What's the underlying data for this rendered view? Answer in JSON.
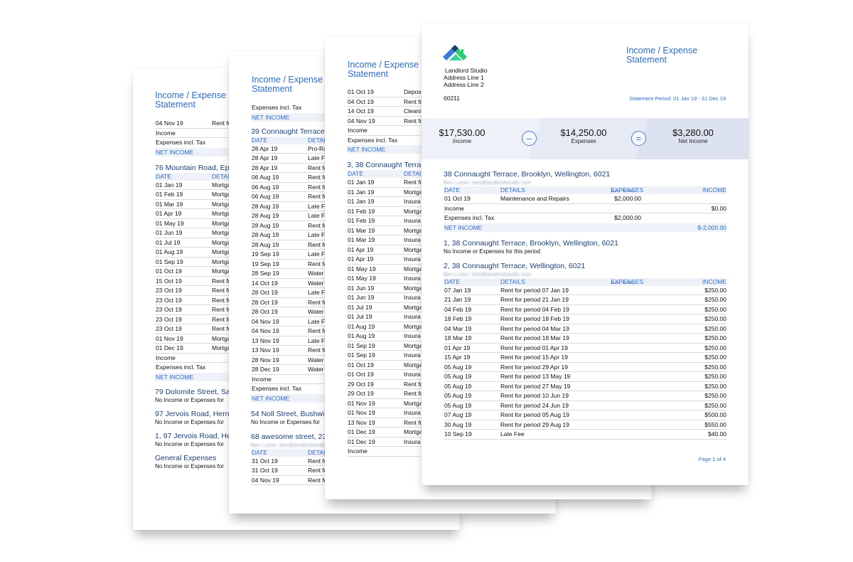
{
  "page1": {
    "title_line1": "Income / Expense",
    "title_line2": "Statement",
    "carry_rows": [
      {
        "date": "04 Nov 19",
        "details": "Rent fo"
      }
    ],
    "income_label": "Income",
    "expenses_label": "Expenses incl. Tax",
    "net_label": "NET INCOME",
    "section1": {
      "title": "76 Mountain Road, Eps",
      "headers": {
        "date": "DATE",
        "details": "DETAI"
      },
      "rows": [
        {
          "date": "01 Jan 19",
          "details": "Mortga"
        },
        {
          "date": "01 Feb 19",
          "details": "Mortga"
        },
        {
          "date": "01 Mar 19",
          "details": "Mortga"
        },
        {
          "date": "01 Apr 19",
          "details": "Mortga"
        },
        {
          "date": "01 May 19",
          "details": "Mortga"
        },
        {
          "date": "01 Jun 19",
          "details": "Mortga"
        },
        {
          "date": "01 Jul 19",
          "details": "Mortga"
        },
        {
          "date": "01 Aug 19",
          "details": "Mortga"
        },
        {
          "date": "01 Sep 19",
          "details": "Mortga"
        },
        {
          "date": "01 Oct 19",
          "details": "Mortga"
        },
        {
          "date": "15 Oct 19",
          "details": "Rent fo"
        },
        {
          "date": "23 Oct 19",
          "details": "Rent fo"
        },
        {
          "date": "23 Oct 19",
          "details": "Rent fo"
        },
        {
          "date": "23 Oct 19",
          "details": "Rent fo"
        },
        {
          "date": "23 Oct 19",
          "details": "Rent fo"
        },
        {
          "date": "23 Oct 19",
          "details": "Rent fo"
        },
        {
          "date": "01 Nov 19",
          "details": "Mortga"
        },
        {
          "date": "01 Dec 19",
          "details": "Mortga"
        }
      ]
    },
    "empty_sections": [
      {
        "title": "79 Dolomite Street, Sa",
        "note": "No Income or Expenses for"
      },
      {
        "title": "97 Jervois Road, Herne",
        "note": "No Income or Expenses for"
      },
      {
        "title": "1, 97 Jervois Road, He",
        "note": "No Income or Expenses for"
      },
      {
        "title": "General Expenses",
        "note": "No Income or Expenses for"
      }
    ]
  },
  "page2": {
    "title_line1": "Income / Expense",
    "title_line2": "Statement",
    "expenses_label": "Expenses incl. Tax",
    "net_label": "NET INCOME",
    "income_label": "Income",
    "section1": {
      "title": "39 Connaught Terrace",
      "headers": {
        "date": "DATE",
        "details": "DETAI"
      },
      "rows": [
        {
          "date": "28 Apr 19",
          "details": "Pro-Ra"
        },
        {
          "date": "28 Apr 19",
          "details": "Late F"
        },
        {
          "date": "28 Apr 19",
          "details": "Rent fo"
        },
        {
          "date": "06 Aug 19",
          "details": "Rent fo"
        },
        {
          "date": "06 Aug 19",
          "details": "Rent fo"
        },
        {
          "date": "06 Aug 19",
          "details": "Rent fo"
        },
        {
          "date": "28 Aug 19",
          "details": "Late F"
        },
        {
          "date": "28 Aug 19",
          "details": "Late F"
        },
        {
          "date": "28 Aug 19",
          "details": "Rent fo"
        },
        {
          "date": "28 Aug 19",
          "details": "Late F"
        },
        {
          "date": "28 Aug 19",
          "details": "Rent fo"
        },
        {
          "date": "19 Sep 19",
          "details": "Late F"
        },
        {
          "date": "19 Sep 19",
          "details": "Rent fo"
        },
        {
          "date": "28 Sep 19",
          "details": "Water"
        },
        {
          "date": "14 Oct 19",
          "details": "Water"
        },
        {
          "date": "28 Oct 19",
          "details": "Late F"
        },
        {
          "date": "28 Oct 19",
          "details": "Rent fo"
        },
        {
          "date": "28 Oct 19",
          "details": "Water"
        },
        {
          "date": "04 Nov 19",
          "details": "Late F"
        },
        {
          "date": "04 Nov 19",
          "details": "Rent fo"
        },
        {
          "date": "13 Nov 19",
          "details": "Late F"
        },
        {
          "date": "13 Nov 19",
          "details": "Rent fo"
        },
        {
          "date": "28 Nov 19",
          "details": "Water"
        },
        {
          "date": "28 Dec 19",
          "details": "Water"
        }
      ]
    },
    "empty_section": {
      "title": "54 Noll Street, Bushwi",
      "note": "No Income or Expenses for"
    },
    "section2": {
      "title": "68 awesome street, 23",
      "contact": "Ben Luxon, ben@landlordstudio",
      "headers": {
        "date": "DATE",
        "details": "DETAI"
      },
      "rows": [
        {
          "date": "31 Oct 19",
          "details": "Rent fo"
        },
        {
          "date": "31 Oct 19",
          "details": "Rent fo"
        },
        {
          "date": "04 Nov 19",
          "details": "Rent fo"
        }
      ]
    }
  },
  "page3": {
    "title_line1": "Income / Expense",
    "title_line2": "Statement",
    "carry_rows": [
      {
        "date": "01 Oct 19",
        "details": "Depos"
      },
      {
        "date": "04 Oct 19",
        "details": "Rent fo"
      },
      {
        "date": "14 Oct 19",
        "details": "Cleani"
      },
      {
        "date": "04 Nov 19",
        "details": "Rent fo"
      }
    ],
    "income_label": "Income",
    "expenses_label": "Expenses incl. Tax",
    "net_label": "NET INCOME",
    "section1": {
      "title": "3, 38 Connaught Terra",
      "headers": {
        "date": "DATE",
        "details": "DETAI"
      },
      "rows": [
        {
          "date": "01 Jan 19",
          "details": "Rent fo"
        },
        {
          "date": "01 Jan 19",
          "details": "Mortga"
        },
        {
          "date": "01 Jan 19",
          "details": "Insura"
        },
        {
          "date": "01 Feb 19",
          "details": "Mortga"
        },
        {
          "date": "01 Feb 19",
          "details": "Insura"
        },
        {
          "date": "01 Mar 19",
          "details": "Mortga"
        },
        {
          "date": "01 Mar 19",
          "details": "Insura"
        },
        {
          "date": "01 Apr 19",
          "details": "Mortga"
        },
        {
          "date": "01 Apr 19",
          "details": "Insura"
        },
        {
          "date": "01 May 19",
          "details": "Mortga"
        },
        {
          "date": "01 May 19",
          "details": "Insura"
        },
        {
          "date": "01 Jun 19",
          "details": "Mortga"
        },
        {
          "date": "01 Jun 19",
          "details": "Insura"
        },
        {
          "date": "01 Jul 19",
          "details": "Mortga"
        },
        {
          "date": "01 Jul 19",
          "details": "Insura"
        },
        {
          "date": "01 Aug 19",
          "details": "Mortga"
        },
        {
          "date": "01 Aug 19",
          "details": "Insura"
        },
        {
          "date": "01 Sep 19",
          "details": "Mortga"
        },
        {
          "date": "01 Sep 19",
          "details": "Insura"
        },
        {
          "date": "01 Oct 19",
          "details": "Mortga"
        },
        {
          "date": "01 Oct 19",
          "details": "Insura"
        },
        {
          "date": "29 Oct 19",
          "details": "Rent fo"
        },
        {
          "date": "29 Oct 19",
          "details": "Rent fo"
        },
        {
          "date": "01 Nov 19",
          "details": "Mortga"
        },
        {
          "date": "01 Nov 19",
          "details": "Insura"
        },
        {
          "date": "13 Nov 19",
          "details": "Rent fo"
        },
        {
          "date": "01 Dec 19",
          "details": "Mortga"
        },
        {
          "date": "01 Dec 19",
          "details": "Insura"
        }
      ]
    }
  },
  "page4": {
    "company": {
      "name": "Landlord Studio",
      "address1": "Address Line 1",
      "address2": "Address Line 2",
      "postcode": "60211"
    },
    "title_line1": "Income / Expense",
    "title_line2": "Statement",
    "period": "Statement Period: 01 Jan 19 - 31 Dec 19",
    "summary": {
      "income_amount": "$17,530.00",
      "income_label": "Income",
      "minus_symbol": "–",
      "expenses_amount": "$14,250.00",
      "expenses_label": "Expenses",
      "equals_symbol": "=",
      "net_amount": "$3,280.00",
      "net_label": "Net Income"
    },
    "headers": {
      "date": "DATE",
      "details": "DETAILS",
      "expenses": "EXPENSES",
      "expenses_note": "(INCL. TAXES)",
      "income": "INCOME"
    },
    "section1": {
      "title": "38 Connaught Terrace, Brooklyn, Wellington, 6021",
      "contact": "Ben Luxon, ben@landlordstudio.com",
      "rows": [
        {
          "date": "01 Oct 19",
          "details": "Maintenance and Repairs",
          "expenses": "$2,000.00",
          "income": ""
        }
      ],
      "income_label": "Income",
      "income_total": "$0.00",
      "expenses_label": "Expenses incl. Tax",
      "expenses_total": "$2,000.00",
      "net_label": "NET INCOME",
      "net_total": "$-2,000.00"
    },
    "section2": {
      "title": "1, 38 Connaught Terrace, Brooklyn, Wellington, 6021",
      "note": "No Income or Expenses for this period"
    },
    "section3": {
      "title": "2, 38 Connaught Terrace, Wellington, 6021",
      "contact": "Ben Luxon, ben@landlordstudio.com",
      "rows": [
        {
          "date": "07 Jan 19",
          "details": "Rent for period 07 Jan 19",
          "expenses": "",
          "income": "$250.00"
        },
        {
          "date": "21 Jan 19",
          "details": "Rent for period 21 Jan 19",
          "expenses": "",
          "income": "$250.00"
        },
        {
          "date": "04 Feb 19",
          "details": "Rent for period 04 Feb 19",
          "expenses": "",
          "income": "$250.00"
        },
        {
          "date": "18 Feb 19",
          "details": "Rent for period 18 Feb 19",
          "expenses": "",
          "income": "$250.00"
        },
        {
          "date": "04 Mar 19",
          "details": "Rent for period 04 Mar 19",
          "expenses": "",
          "income": "$250.00"
        },
        {
          "date": "18 Mar 19",
          "details": "Rent for period 18 Mar 19",
          "expenses": "",
          "income": "$250.00"
        },
        {
          "date": "01 Apr 19",
          "details": "Rent for period 01 Apr 19",
          "expenses": "",
          "income": "$250.00"
        },
        {
          "date": "15 Apr 19",
          "details": "Rent for period 15 Apr 19",
          "expenses": "",
          "income": "$250.00"
        },
        {
          "date": "05 Aug 19",
          "details": "Rent for period 29 Apr 19",
          "expenses": "",
          "income": "$250.00"
        },
        {
          "date": "05 Aug 19",
          "details": "Rent for period 13 May 19",
          "expenses": "",
          "income": "$250.00"
        },
        {
          "date": "05 Aug 19",
          "details": "Rent for period 27 May 19",
          "expenses": "",
          "income": "$250.00"
        },
        {
          "date": "05 Aug 19",
          "details": "Rent for period 10 Jun 19",
          "expenses": "",
          "income": "$250.00"
        },
        {
          "date": "05 Aug 19",
          "details": "Rent for period 24 Jun 19",
          "expenses": "",
          "income": "$250.00"
        },
        {
          "date": "07 Aug 19",
          "details": "Rent for period 05 Aug 19",
          "expenses": "",
          "income": "$500.00"
        },
        {
          "date": "30 Aug 19",
          "details": "Rent for period 29 Aug 19",
          "expenses": "",
          "income": "$550.00"
        },
        {
          "date": "10 Sep 19",
          "details": "Late Fee",
          "expenses": "",
          "income": "$40.00"
        }
      ]
    },
    "page_number": "Page 1 of 4",
    "brand_colors": {
      "logo_dark": "#1b3a63",
      "logo_blue": "#3a7be0",
      "logo_green": "#2ecc71",
      "logo_teal": "#3fd19a",
      "accent": "#2d6cc0"
    }
  }
}
